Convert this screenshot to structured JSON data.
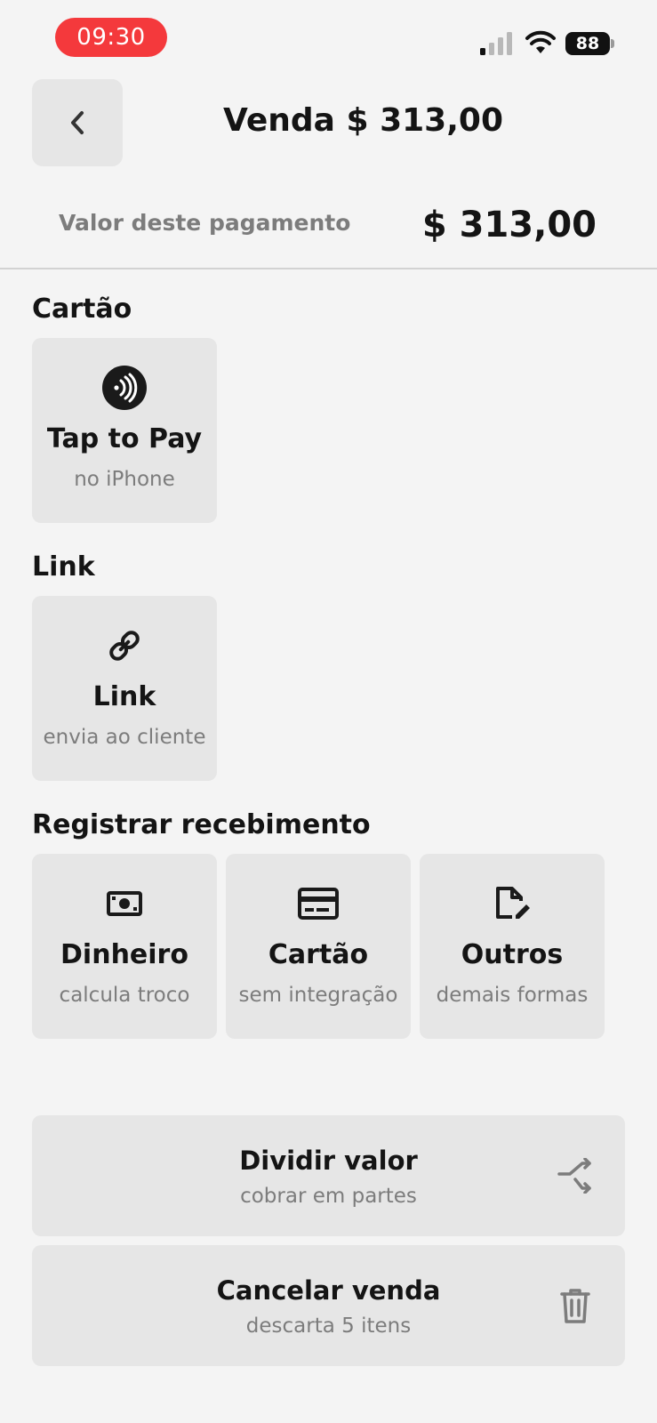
{
  "status_bar": {
    "time": "09:30",
    "battery": "88"
  },
  "header": {
    "title": "Venda $ 313,00"
  },
  "payment": {
    "label": "Valor deste pagamento",
    "amount": "$ 313,00"
  },
  "sections": {
    "card": {
      "title": "Cartão",
      "tiles": [
        {
          "title": "Tap to Pay",
          "subtitle": "no iPhone",
          "icon": "contactless-icon"
        }
      ]
    },
    "link": {
      "title": "Link",
      "tiles": [
        {
          "title": "Link",
          "subtitle": "envia ao cliente",
          "icon": "link-icon"
        }
      ]
    },
    "register": {
      "title": "Registrar recebimento",
      "tiles": [
        {
          "title": "Dinheiro",
          "subtitle": "calcula troco",
          "icon": "cash-icon"
        },
        {
          "title": "Cartão",
          "subtitle": "sem integração",
          "icon": "credit-card-icon"
        },
        {
          "title": "Outros",
          "subtitle": "demais formas",
          "icon": "edit-document-icon"
        }
      ]
    }
  },
  "actions": {
    "split": {
      "title": "Dividir valor",
      "subtitle": "cobrar em partes",
      "icon": "split-arrows-icon"
    },
    "cancel": {
      "title": "Cancelar venda",
      "subtitle": "descarta 5 itens",
      "icon": "trash-icon"
    }
  }
}
